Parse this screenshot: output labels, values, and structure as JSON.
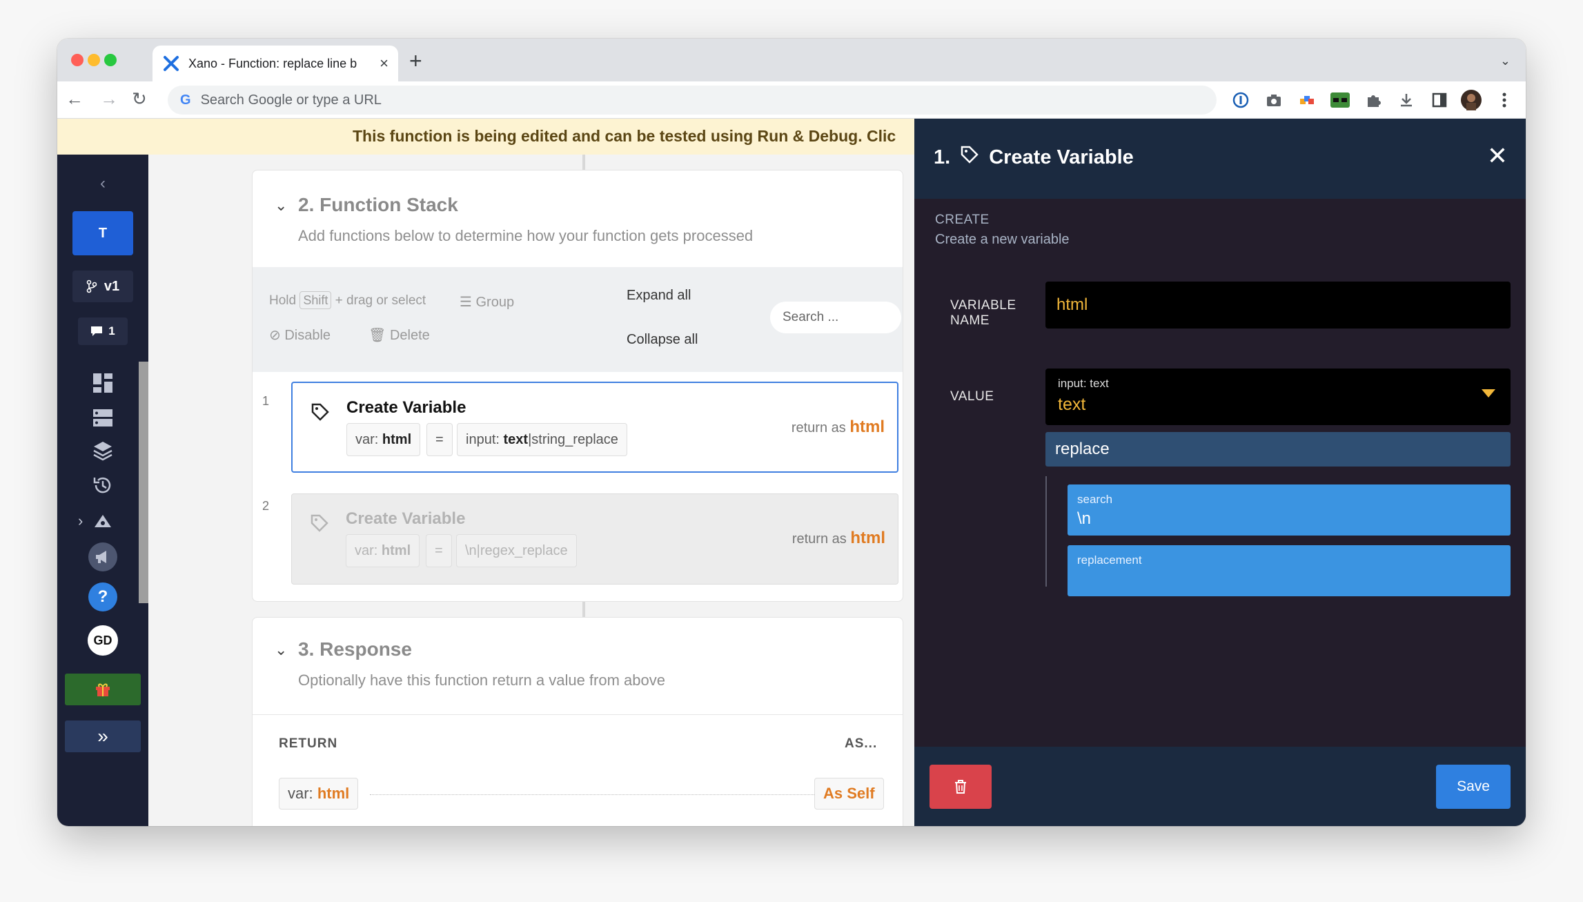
{
  "browser": {
    "tab_title": "Xano - Function: replace line b",
    "tab_close": "×",
    "new_tab": "+",
    "address_placeholder": "Search Google or type a URL",
    "google_g": "G"
  },
  "colors": {
    "accent": "#2f80e0",
    "panel_bg": "#231d2b",
    "panel_head": "#1b2a40",
    "highlight": "#f2b73a",
    "return_orange": "#e07b22",
    "danger": "#d9434b",
    "banner_bg": "#fdf3d2"
  },
  "banner": {
    "text": "This function is being edited and can be tested using Run & Debug. Clic"
  },
  "sidebar": {
    "workspace_initial": "T",
    "branch": "v1",
    "comments_count": "1",
    "user_initials": "GD",
    "icons": [
      "chevron-left-icon",
      "branch-icon",
      "comment-icon",
      "dashboard-icon",
      "database-icon",
      "api-icon",
      "history-icon",
      "chevron-right-icon",
      "megaphone-icon",
      "help-icon",
      "gift-icon",
      "double-chevron-icon"
    ]
  },
  "function_stack": {
    "title": "2. Function Stack",
    "subtitle": "Add functions below to determine how your function gets processed",
    "toolbar": {
      "hold": "Hold",
      "shift": "Shift",
      "drag_select": "+ drag or select",
      "group": "Group",
      "disable": "Disable",
      "delete": "Delete",
      "expand_all": "Expand all",
      "collapse_all": "Collapse all",
      "search_placeholder": "Search ..."
    },
    "steps": [
      {
        "num": "1",
        "name": "Create Variable",
        "var_prefix": "var:",
        "var_name": "html",
        "equals": "=",
        "value_prefix": "input:",
        "value_name": "text",
        "value_filter": "|string_replace",
        "return_label": "return as",
        "return_var": "html"
      },
      {
        "num": "2",
        "name": "Create Variable",
        "var_prefix": "var:",
        "var_name": "html",
        "equals": "=",
        "value_text": "\\n|regex_replace",
        "return_label": "return as",
        "return_var": "html"
      }
    ]
  },
  "response": {
    "title": "3. Response",
    "subtitle": "Optionally have this function return a value from above",
    "return_header": "RETURN",
    "as_header": "AS...",
    "return_var_prefix": "var:",
    "return_var": "html",
    "as_value": "As Self"
  },
  "panel": {
    "step_number": "1.",
    "title": "Create Variable",
    "close": "✕",
    "section_label": "CREATE",
    "section_desc": "Create a new variable",
    "var_name_label_1": "VARIABLE",
    "var_name_label_2": "NAME",
    "var_name_value": "html",
    "value_label": "VALUE",
    "value_source": "input: text",
    "value_text": "text",
    "filter_name": "replace",
    "args": [
      {
        "label": "search",
        "value": "\\n"
      },
      {
        "label": "replacement",
        "value": ""
      }
    ],
    "save_label": "Save"
  }
}
